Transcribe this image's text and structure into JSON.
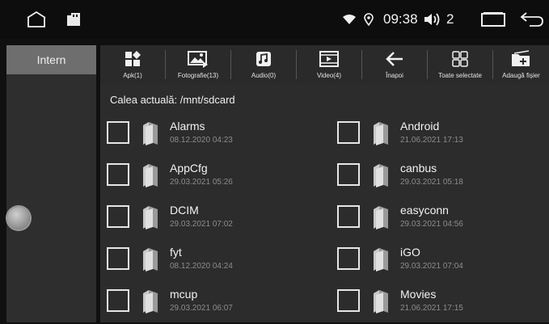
{
  "status": {
    "time": "09:38",
    "volume": "2"
  },
  "sidebar": {
    "tab_label": "Intern"
  },
  "toolbar": {
    "items": [
      {
        "label": "Apk(1)",
        "icon": "apk-icon"
      },
      {
        "label": "Fotografie(13)",
        "icon": "photo-icon"
      },
      {
        "label": "Audio(0)",
        "icon": "music-icon"
      },
      {
        "label": "Video(4)",
        "icon": "video-icon"
      },
      {
        "label": "Înapoi",
        "icon": "back-arrow-icon"
      },
      {
        "label": "Toate selectate",
        "icon": "select-all-icon"
      },
      {
        "label": "Adaugă fișier",
        "icon": "add-folder-icon"
      }
    ]
  },
  "content": {
    "path": "Calea actuală: /mnt/sdcard",
    "files": [
      {
        "name": "Alarms",
        "date": "08.12.2020 04:23"
      },
      {
        "name": "Android",
        "date": "21.06.2021 17:13"
      },
      {
        "name": "AppCfg",
        "date": "29.03.2021 05:26"
      },
      {
        "name": "canbus",
        "date": "29.03.2021 05:18"
      },
      {
        "name": "DCIM",
        "date": "29.03.2021 07:02"
      },
      {
        "name": "easyconn",
        "date": "29.03.2021 04:56"
      },
      {
        "name": "fyt",
        "date": "08.12.2020 04:24"
      },
      {
        "name": "iGO",
        "date": "29.03.2021 07:04"
      },
      {
        "name": "mcup",
        "date": "29.03.2021 06:07"
      },
      {
        "name": "Movies",
        "date": "21.06.2021 17:15"
      }
    ]
  }
}
